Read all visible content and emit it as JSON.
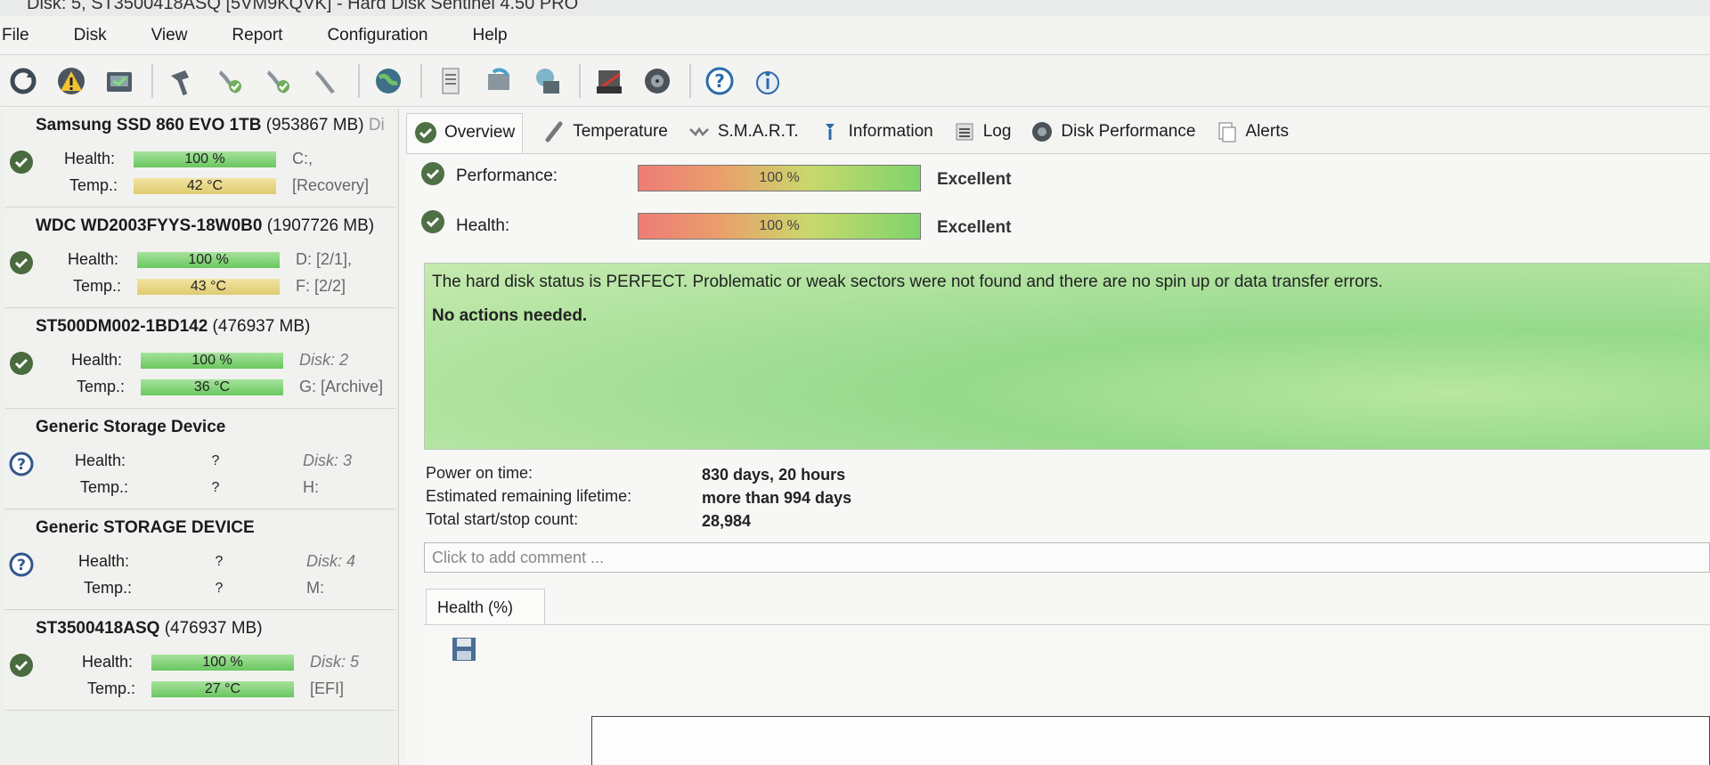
{
  "window": {
    "title": "Disk: 5, ST3500418ASQ [5VM9KQVK]  -  Hard Disk Sentinel 4.50 PRO"
  },
  "menu": {
    "file": "File",
    "disk": "Disk",
    "view": "View",
    "report": "Report",
    "configuration": "Configuration",
    "help": "Help"
  },
  "toolbar": {
    "icons": [
      "refresh-icon",
      "warning-icon",
      "disk-drive-icon",
      "hammer-icon",
      "wrench-check-icon",
      "wrench-check-2-icon",
      "wrench-icon",
      "globe-icon",
      "report-icon",
      "refresh-disk-icon",
      "network-disk-icon",
      "print-icon",
      "disk-performance-icon",
      "help-icon",
      "info-icon"
    ]
  },
  "disks": [
    {
      "name": "Samsung SSD 860 EVO 1TB",
      "size": "(953867 MB)",
      "suffix": "Di",
      "health_label": "Health:",
      "health": "100 %",
      "health_fill": 1.0,
      "temp_label": "Temp.:",
      "temp": "42 °C",
      "side1": "C:,",
      "side2": "[Recovery]",
      "status": "ok"
    },
    {
      "name": "WDC WD2003FYYS-18W0B0",
      "size": "(1907726 MB)",
      "suffix": "",
      "health_label": "Health:",
      "health": "100 %",
      "health_fill": 1.0,
      "temp_label": "Temp.:",
      "temp": "43 °C",
      "side1": "D: [2/1],",
      "side2": "F: [2/2]",
      "status": "ok"
    },
    {
      "name": "ST500DM002-1BD142",
      "size": "(476937 MB)",
      "suffix": "",
      "health_label": "Health:",
      "health": "100 %",
      "health_fill": 1.0,
      "temp_label": "Temp.:",
      "temp": "36 °C",
      "side1": "Disk: 2",
      "side2": "G: [Archive]",
      "status": "ok"
    },
    {
      "name": "Generic Storage Device",
      "size": "",
      "suffix": "",
      "health_label": "Health:",
      "health": "?",
      "temp_label": "Temp.:",
      "temp": "?",
      "side1": "Disk: 3",
      "side2": "H:",
      "status": "unknown"
    },
    {
      "name": "Generic STORAGE DEVICE",
      "size": "",
      "suffix": "",
      "health_label": "Health:",
      "health": "?",
      "temp_label": "Temp.:",
      "temp": "?",
      "side1": "Disk: 4",
      "side2": "M:",
      "status": "unknown"
    },
    {
      "name": "ST3500418ASQ",
      "size": "(476937 MB)",
      "suffix": "",
      "health_label": "Health:",
      "health": "100 %",
      "health_fill": 1.0,
      "temp_label": "Temp.:",
      "temp": "27 °C",
      "side1": "Disk: 5",
      "side2": "[EFI]",
      "status": "ok"
    }
  ],
  "tabs": [
    {
      "label": "Overview",
      "icon": "check-icon",
      "active": true
    },
    {
      "label": "Temperature",
      "icon": "thermometer-icon"
    },
    {
      "label": "S.M.A.R.T.",
      "icon": "smart-icon"
    },
    {
      "label": "Information",
      "icon": "info-icon"
    },
    {
      "label": "Log",
      "icon": "log-icon"
    },
    {
      "label": "Disk Performance",
      "icon": "performance-icon"
    },
    {
      "label": "Alerts",
      "icon": "alerts-icon"
    }
  ],
  "overview": {
    "performance_label": "Performance:",
    "performance_value": "100 %",
    "performance_fill": 1.0,
    "performance_rating": "Excellent",
    "health_label": "Health:",
    "health_value": "100 %",
    "health_fill": 1.0,
    "health_rating": "Excellent",
    "status_text": "The hard disk status is PERFECT. Problematic or weak sectors were not found and there are no spin up or data transfer errors.",
    "status_action": "No actions needed.",
    "power_on_label": "Power on time:",
    "power_on_value": "830 days, 20 hours",
    "lifetime_label": "Estimated remaining lifetime:",
    "lifetime_value": "more than 994 days",
    "startstop_label": "Total start/stop count:",
    "startstop_value": "28,984",
    "comment_placeholder": "Click to add comment ...",
    "subtab_label": "Health (%)"
  },
  "colors": {
    "bar_green": "#69c75f",
    "bar_yellow": "#e0cb70",
    "status_ok": "#4a7a3a",
    "status_unknown": "#3f67a8"
  }
}
